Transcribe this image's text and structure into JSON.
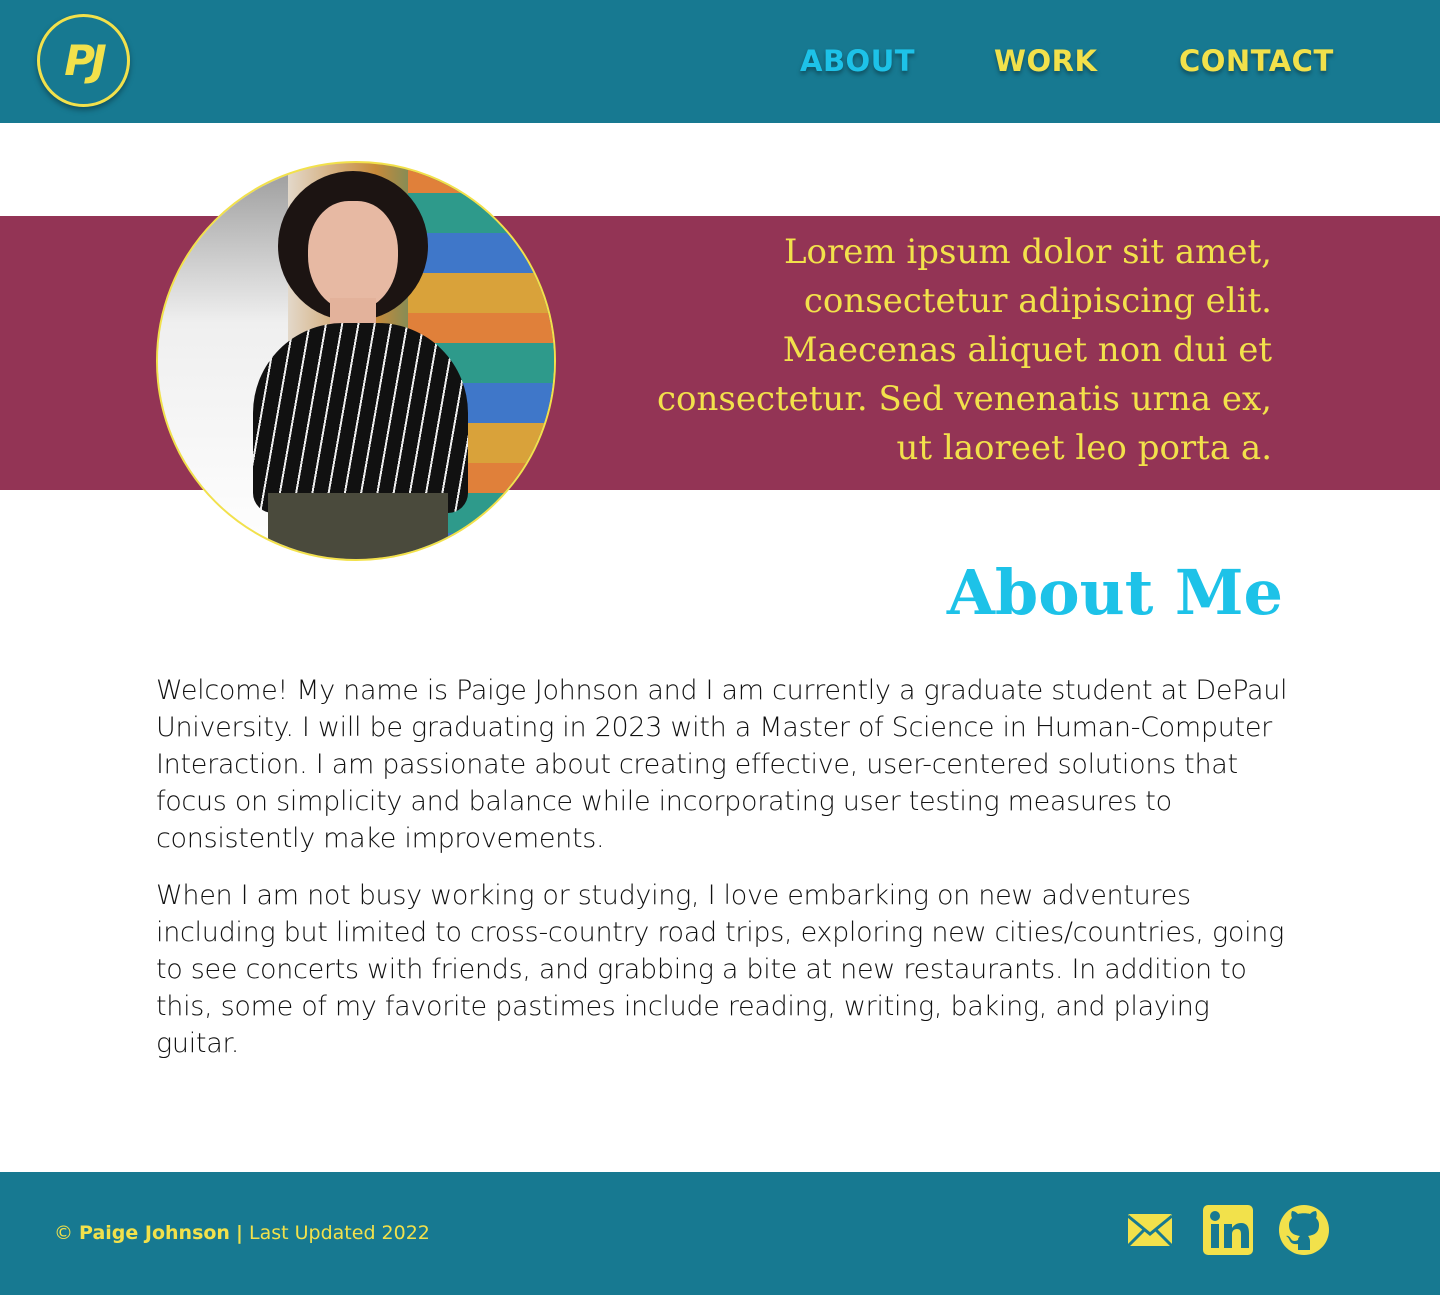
{
  "logo": {
    "text": "PJ"
  },
  "nav": {
    "about": "ABOUT",
    "work": "WORK",
    "contact": "CONTACT"
  },
  "hero": {
    "quote": "Lorem ipsum dolor sit amet, consectetur adipiscing elit. Maecenas aliquet non dui et consectetur. Sed venenatis urna ex, ut laoreet leo porta a."
  },
  "about": {
    "title": "About Me",
    "paragraphs": [
      "Welcome! My name is Paige Johnson and I am currently a graduate student at DePaul University. I will be graduating in 2023 with a Master of Science in Human-Computer Interaction. I am passionate about creating effective, user-centered solutions that focus on simplicity and balance while incorporating user testing measures to consistently make improvements.",
      "When I am not busy working or studying, I love embarking on new adventures including but limited to cross-country road trips, exploring new cities/countries, going to see concerts with friends, and grabbing a bite at new restaurants. In addition to this, some of my favorite pastimes include reading, writing, baking, and playing guitar."
    ]
  },
  "footer": {
    "copyright": "©",
    "name": "Paige Johnson",
    "separator": "|",
    "updated": "Last Updated 2022",
    "icons": [
      "mail-icon",
      "linkedin-icon",
      "github-icon"
    ]
  },
  "colors": {
    "header_bg": "#177991",
    "accent_yellow": "#f2e14b",
    "accent_cyan": "#1dc2e8",
    "band_bg": "#933455"
  }
}
